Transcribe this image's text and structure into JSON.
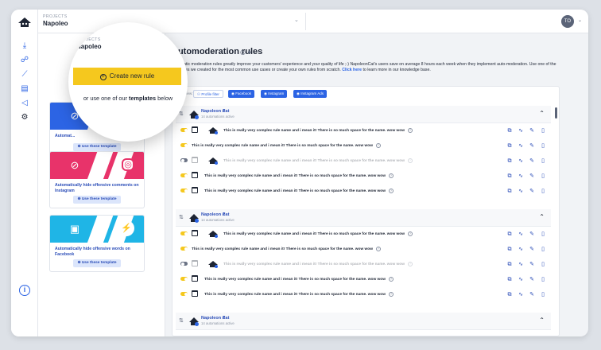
{
  "topbar": {
    "project_label": "PROJECTS",
    "project_name": "Napoleo",
    "avatar_initials": "TO"
  },
  "magnifier": {
    "project_label": "PROJECTS",
    "project_name": "Napoleo",
    "create_rule_label": "Create new rule",
    "or_text_prefix": "or use one of our ",
    "or_text_bold": "templates",
    "or_text_suffix": " below"
  },
  "templates": [
    {
      "title": "Automat...",
      "title_right": "acebook",
      "button": "Use these template",
      "color": "#2c64e4",
      "network": "facebook"
    },
    {
      "title": "Automatically hide offensive comments on Instagram",
      "button": "Use these template",
      "color": "#e8336a",
      "network": "instagram"
    },
    {
      "title": "Automatically hide offensive words on Facebook",
      "button": "Use these template",
      "color": "#1fb5e6",
      "network": "messenger"
    }
  ],
  "main": {
    "title": "Automoderation rules",
    "description_1": "Automatic moderation rules greatly improve your customers' experience and your quality of life ;-) NapoleonCat's users save on average 8 hours each week when they implement auto-moderation. Use one of the templates we created for the most common use cases or create your own rules from scratch. ",
    "description_link": "Click here",
    "description_2": " to learn more in our knowledge base."
  },
  "filters": {
    "label": "Filter view:",
    "chips": [
      "Profile filter",
      "Facebook",
      "Instagram",
      "Instagram Ads"
    ]
  },
  "groups": [
    {
      "name": "Napoleon Cat",
      "sub": "14 automations active",
      "rules": [
        {
          "text": "This is really very complex rule name and i mean it! There is so much space for the name. wow wow",
          "state": "on",
          "logo": true
        },
        {
          "text": "This is really very complex rule name and i mean it! There is so much space for the name. wow wow",
          "state": "on",
          "logo": false
        },
        {
          "text": "This is really very complex rule name and i mean it! There is so much space for the name. wow wow",
          "state": "off",
          "logo": true
        },
        {
          "text": "This is really very complex rule name and i mean it! There is so much space for the name. wow wow",
          "state": "on",
          "logo": false
        },
        {
          "text": "This is really very complex rule name and i mean it! There is so much space for the name. wow wow",
          "state": "on",
          "logo": false
        }
      ]
    },
    {
      "name": "Napoleon Cat",
      "sub": "14 automations active",
      "rules": [
        {
          "text": "This is really very complex rule name and i mean it! There is so much space for the name. wow wow",
          "state": "on",
          "logo": true
        },
        {
          "text": "This is really very complex rule name and i mean it! There is so much space for the name. wow wow",
          "state": "on",
          "logo": false
        },
        {
          "text": "This is really very complex rule name and i mean it! There is so much space for the name. wow wow",
          "state": "off",
          "logo": true
        },
        {
          "text": "This is really very complex rule name and i mean it! There is so much space for the name. wow wow",
          "state": "on",
          "logo": false
        },
        {
          "text": "This is really very complex rule name and i mean it! There is so much space for the name. wow wow",
          "state": "on",
          "logo": false
        }
      ]
    },
    {
      "name": "Napoleon Cat",
      "sub": "14 automations active",
      "rules": []
    }
  ],
  "colors": {
    "accent": "#2c64e4",
    "yellow": "#f5c81e"
  }
}
